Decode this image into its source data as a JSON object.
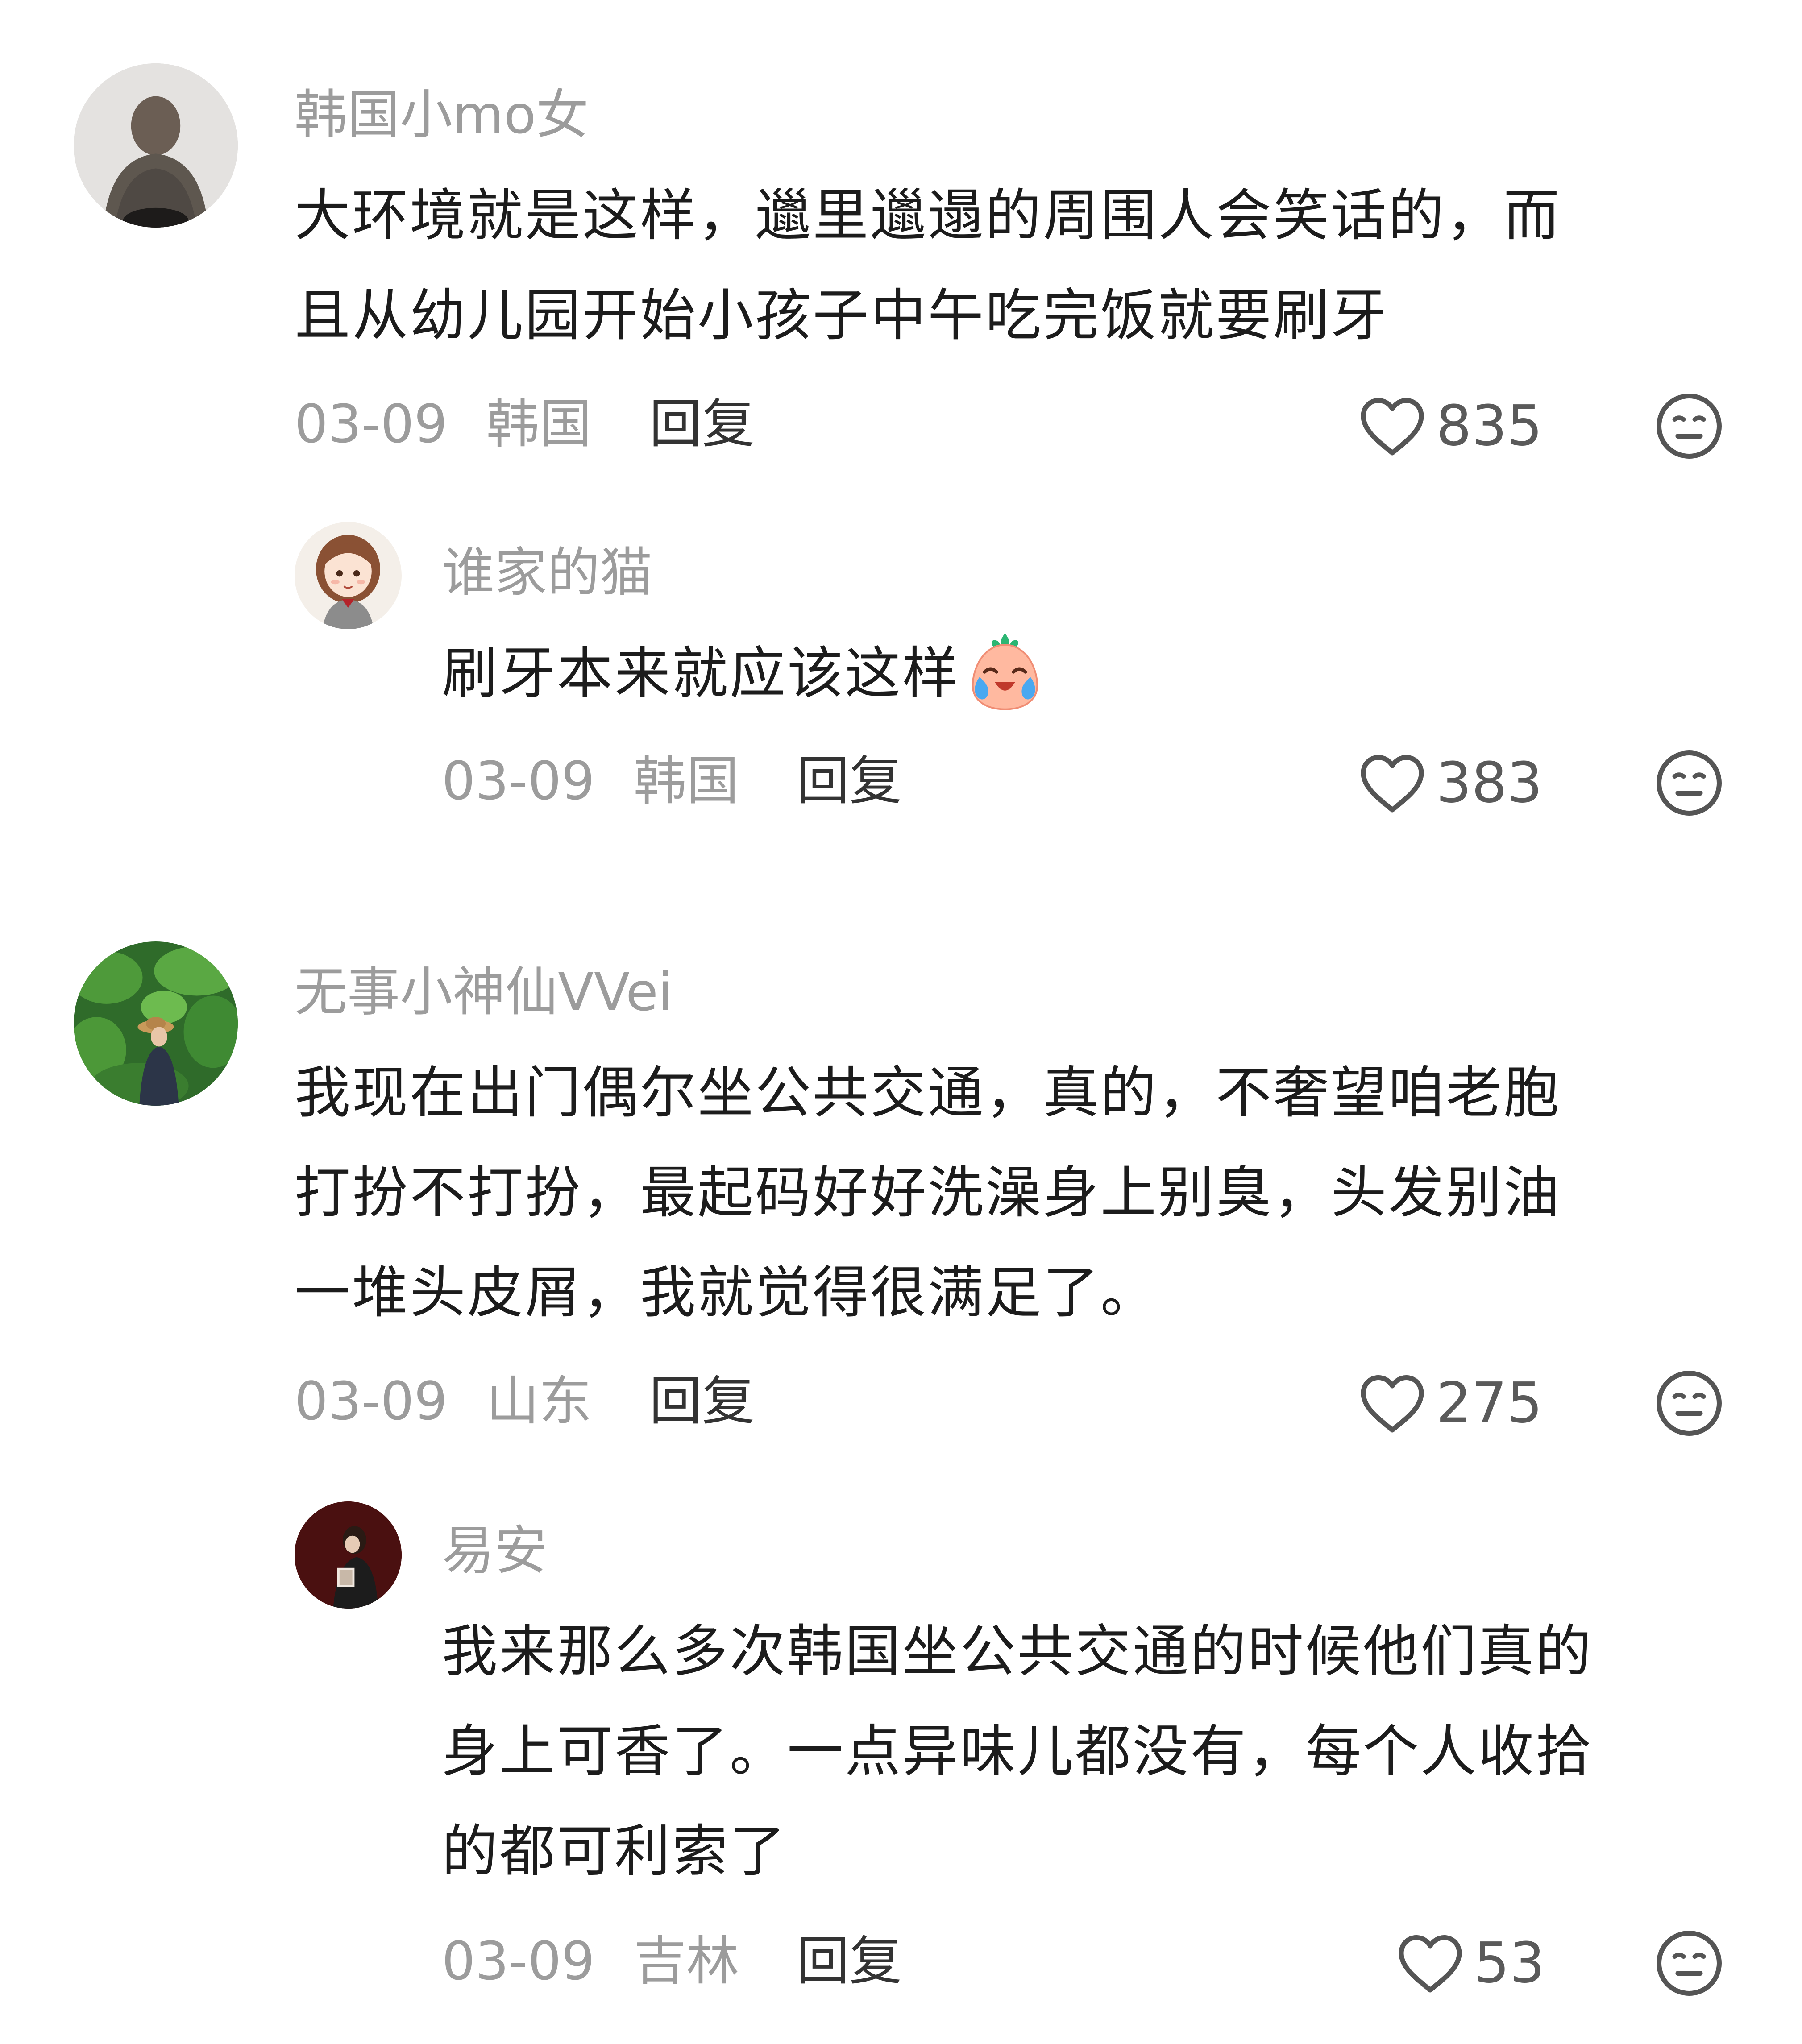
{
  "comments": [
    {
      "username": "韩国小mo女",
      "text": "大环境就是这样，邋里邋遢的周围人会笑话的，而且从幼儿园开始小孩子中午吃完饭就要刷牙",
      "lines": [
        "大环境就是这样，邋里邋遢的周围人会笑话的，而",
        "且从幼儿园开始小孩子中午吃完饭就要刷牙"
      ],
      "date": "03-09",
      "location": "韩国",
      "reply_label": "回复",
      "likes": "835",
      "avatar": "photo-sweater-avatar"
    },
    {
      "username": "谁家的猫",
      "text": "刷牙本来就应该这样",
      "emoji": "laughing-crying-emoji",
      "date": "03-09",
      "location": "韩国",
      "reply_label": "回复",
      "likes": "383",
      "avatar": "cartoon-girl-avatar"
    },
    {
      "username": "无事小神仙VVei",
      "text": "我现在出门偶尔坐公共交通，真的，不奢望咱老胞打扮不打扮，最起码好好洗澡身上别臭，头发别油一堆头皮屑，我就觉得很满足了。",
      "lines": [
        "我现在出门偶尔坐公共交通，真的，不奢望咱老胞",
        "打扮不打扮，最起码好好洗澡身上别臭，头发别油",
        "一堆头皮屑，我就觉得很满足了。"
      ],
      "date": "03-09",
      "location": "山东",
      "reply_label": "回复",
      "likes": "275",
      "avatar": "photo-plants-avatar"
    },
    {
      "username": "易安",
      "text": "我来那么多次韩国坐公共交通的时候他们真的身上可香了。一点异味儿都没有，每个人收拾的都可利索了",
      "lines": [
        "我来那么多次韩国坐公共交通的时候他们真的",
        "身上可香了。一点异味儿都没有，每个人收拾",
        "的都可利索了"
      ],
      "date": "03-09",
      "location": "吉林",
      "reply_label": "回复",
      "likes": "53",
      "avatar": "photo-dark-red-avatar"
    }
  ],
  "colors": {
    "background": "#ffffff",
    "username": "#9c9c9c",
    "body_text": "#1c1c1c",
    "meta": "#9c9c9c",
    "reply": "#333333",
    "icon_stroke": "#555555"
  },
  "icons": {
    "like": "heart-outline-icon",
    "dislike": "neutral-face-icon"
  }
}
